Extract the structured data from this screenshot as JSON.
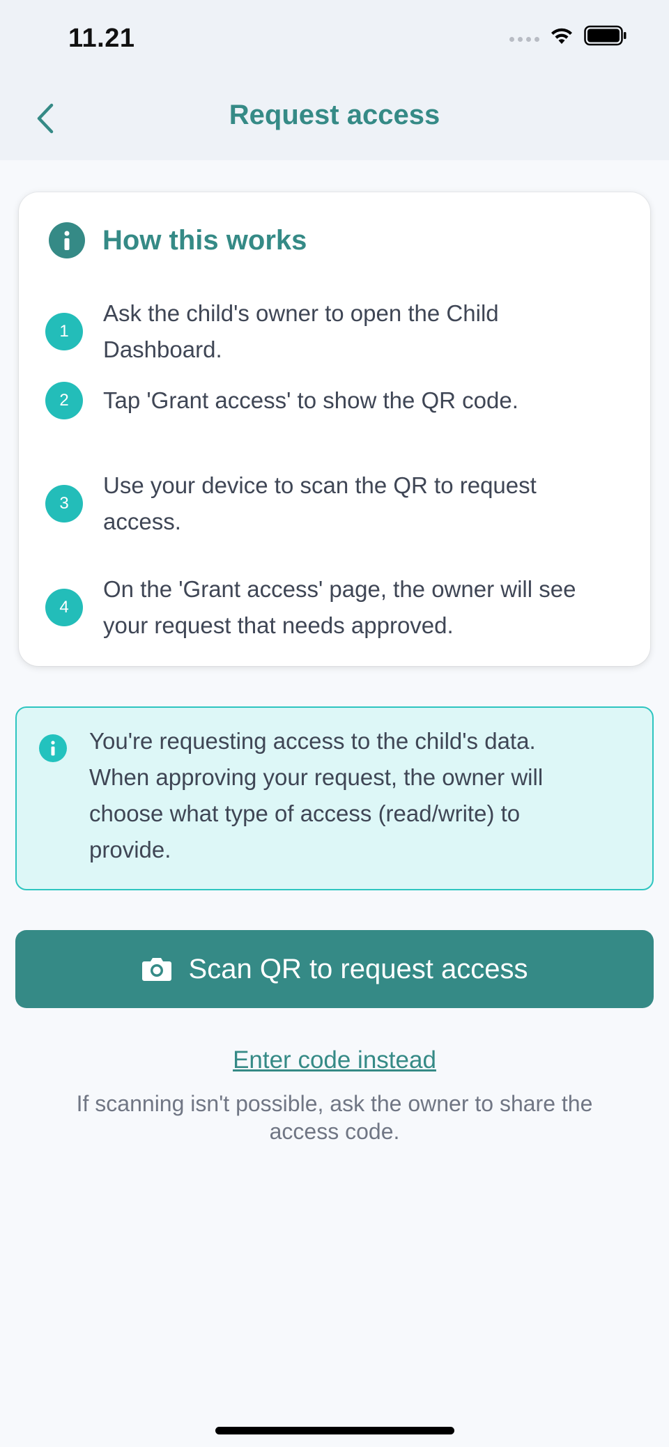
{
  "status_bar": {
    "time": "11.21"
  },
  "header": {
    "title": "Request access"
  },
  "how_card": {
    "title": "How this works",
    "steps": [
      {
        "num": "1",
        "lines": [
          "Ask the child's owner to open the Child",
          "Dashboard."
        ]
      },
      {
        "num": "2",
        "lines": [
          "Tap 'Grant access' to show the QR code."
        ]
      },
      {
        "num": "3",
        "lines": [
          "Use your device to scan the QR to request",
          "access."
        ]
      },
      {
        "num": "4",
        "lines": [
          "On the 'Grant access' page, the owner will see",
          "your request that needs approved."
        ]
      }
    ]
  },
  "note": {
    "lines": [
      "You're requesting access to the child's data.",
      "When approving your request, the owner will",
      "choose what type of access (read/write) to",
      "provide."
    ]
  },
  "scan_button": {
    "label": "Scan QR to request access"
  },
  "enter_code": {
    "label": "Enter code instead"
  },
  "hint": {
    "lines": [
      "If scanning isn't possible, ask the owner to share the",
      "access code."
    ]
  },
  "colors": {
    "accent": "#358a86",
    "step_circle": "#23bdb9",
    "note_bg": "#ddf7f7",
    "note_border": "#2dc5c0"
  },
  "icons": {
    "back": "chevron-left-icon",
    "info": "info-icon",
    "camera": "camera-icon",
    "wifi": "wifi-icon",
    "battery": "battery-icon"
  }
}
